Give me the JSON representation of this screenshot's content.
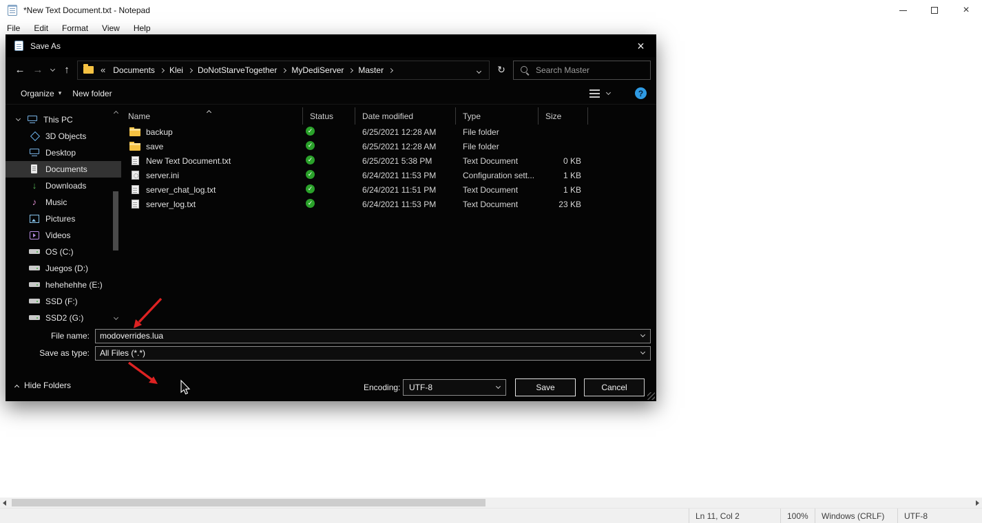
{
  "icons": {
    "back_arrow": "←",
    "forward_arrow": "→",
    "up_arrow": "↑",
    "refresh": "↻",
    "window_close": "×",
    "dialog_close": "×",
    "organize_caret": "▾",
    "breadcrumb_overflow": "«",
    "help": "?"
  },
  "notepad": {
    "window_title": "*New Text Document.txt - Notepad",
    "menu_items": [
      "File",
      "Edit",
      "Format",
      "View",
      "Help"
    ],
    "statusbar": {
      "cursor_position": "Ln 11, Col 2",
      "zoom": "100%",
      "line_endings": "Windows (CRLF)",
      "encoding": "UTF-8"
    }
  },
  "save_dialog": {
    "title": "Save As",
    "toolbar": {
      "organize": "Organize",
      "new_folder": "New folder"
    },
    "breadcrumb": {
      "items": [
        "Documents",
        "Klei",
        "DoNotStarveTogether",
        "MyDediServer",
        "Master"
      ]
    },
    "search": {
      "placeholder": "Search Master"
    },
    "sidebar": {
      "items": [
        {
          "label": "This PC",
          "icon": "pc"
        },
        {
          "label": "3D Objects",
          "icon": "3d"
        },
        {
          "label": "Desktop",
          "icon": "desktop"
        },
        {
          "label": "Documents",
          "icon": "documents",
          "selected": true
        },
        {
          "label": "Downloads",
          "icon": "downloads"
        },
        {
          "label": "Music",
          "icon": "music"
        },
        {
          "label": "Pictures",
          "icon": "pictures"
        },
        {
          "label": "Videos",
          "icon": "videos"
        },
        {
          "label": "OS (C:)",
          "icon": "drive"
        },
        {
          "label": "Juegos (D:)",
          "icon": "drive"
        },
        {
          "label": "hehehehhe (E:)",
          "icon": "drive"
        },
        {
          "label": "SSD (F:)",
          "icon": "drive"
        },
        {
          "label": "SSD2 (G:)",
          "icon": "drive"
        }
      ]
    },
    "columns": [
      "Name",
      "Status",
      "Date modified",
      "Type",
      "Size"
    ],
    "files": [
      {
        "name": "backup",
        "icon": "folder",
        "status": "synced",
        "date": "6/25/2021 12:28 AM",
        "type": "File folder",
        "size": ""
      },
      {
        "name": "save",
        "icon": "folder",
        "status": "synced",
        "date": "6/25/2021 12:28 AM",
        "type": "File folder",
        "size": ""
      },
      {
        "name": "New Text Document.txt",
        "icon": "text",
        "status": "synced",
        "date": "6/25/2021 5:38 PM",
        "type": "Text Document",
        "size": "0 KB"
      },
      {
        "name": "server.ini",
        "icon": "ini",
        "status": "synced",
        "date": "6/24/2021 11:53 PM",
        "type": "Configuration sett...",
        "size": "1 KB"
      },
      {
        "name": "server_chat_log.txt",
        "icon": "text",
        "status": "synced",
        "date": "6/24/2021 11:51 PM",
        "type": "Text Document",
        "size": "1 KB"
      },
      {
        "name": "server_log.txt",
        "icon": "text",
        "status": "synced",
        "date": "6/24/2021 11:53 PM",
        "type": "Text Document",
        "size": "23 KB"
      }
    ],
    "file_name": {
      "label": "File name:",
      "value": "modoverrides.lua"
    },
    "save_as_type": {
      "label": "Save as type:",
      "value": "All Files (*.*)"
    },
    "footer": {
      "hide_folders": "Hide Folders",
      "encoding_label": "Encoding:",
      "encoding_value": "UTF-8",
      "save": "Save",
      "cancel": "Cancel"
    }
  }
}
